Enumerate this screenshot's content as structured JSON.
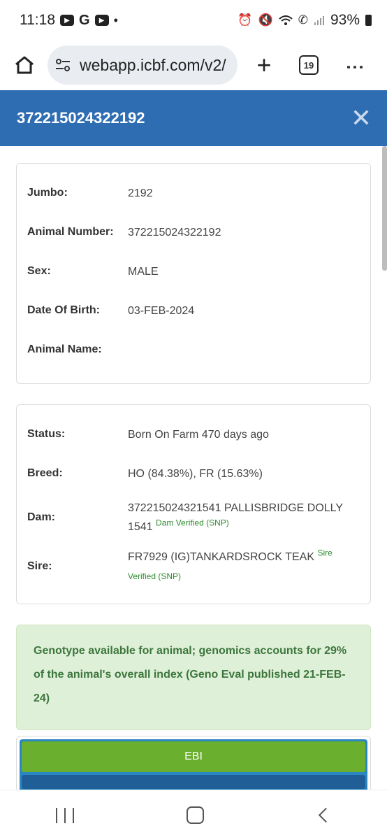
{
  "status_bar": {
    "time": "11:18",
    "left_icons": [
      "youtube-icon",
      "google-icon",
      "youtube-icon",
      "dot-icon"
    ],
    "right_icons": [
      "alarm-icon",
      "mute-icon",
      "wifi-icon",
      "wifi-call-icon",
      "signal-icon"
    ],
    "battery": "93%"
  },
  "browser": {
    "url": "webapp.icbf.com/v2/",
    "tab_count": "19"
  },
  "modal": {
    "title": "372215024322192"
  },
  "identity_card": {
    "rows": [
      {
        "label": "Jumbo:",
        "value": "2192"
      },
      {
        "label": "Animal Number:",
        "value": "372215024322192"
      },
      {
        "label": "Sex:",
        "value": "MALE"
      },
      {
        "label": "Date Of Birth:",
        "value": "03-FEB-2024"
      },
      {
        "label": "Animal Name:",
        "value": ""
      }
    ]
  },
  "status_card": {
    "status_label": "Status:",
    "status_value": "Born On Farm 470 days ago",
    "breed_label": "Breed:",
    "breed_value": "HO (84.38%), FR (15.63%)",
    "dam_label": "Dam:",
    "dam_value": "372215024321541 PALLISBRIDGE DOLLY 1541",
    "dam_verified": "Dam Verified (SNP)",
    "sire_label": "Sire:",
    "sire_value": "FR7929 (IG)TANKARDSROCK TEAK",
    "sire_verified_1": "Sire",
    "sire_verified_2": "Verified (SNP)"
  },
  "genotype_notice": "Genotype available for animal; genomics accounts for 29% of the animal's overall index (Geno Eval published 21-FEB-24)",
  "tabs": {
    "ebi_label": "EBI"
  },
  "colors": {
    "header_blue": "#2f6db3",
    "notice_green_bg": "#dff0d8",
    "notice_green_text": "#3c763d",
    "ebi_green": "#6ab02e",
    "verified_green": "#2e8b2e"
  }
}
